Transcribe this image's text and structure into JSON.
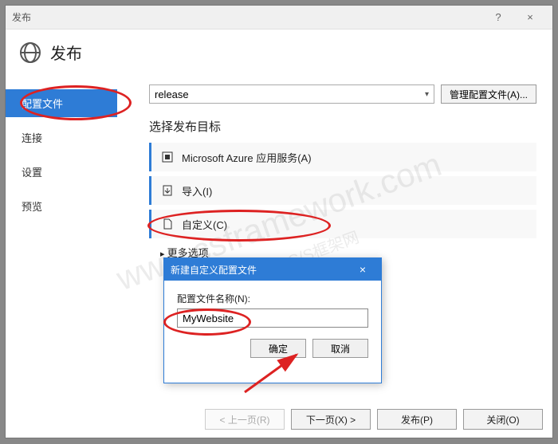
{
  "titlebar": {
    "title": "发布",
    "help": "?",
    "close": "×"
  },
  "header": {
    "title": "发布"
  },
  "sidebar": {
    "items": [
      {
        "label": "配置文件",
        "active": true
      },
      {
        "label": "连接"
      },
      {
        "label": "设置"
      },
      {
        "label": "预览"
      }
    ]
  },
  "config": {
    "selected": "release",
    "manage_label": "管理配置文件(A)..."
  },
  "targets": {
    "heading": "选择发布目标",
    "items": [
      {
        "icon": "azure",
        "label": "Microsoft Azure 应用服务(A)"
      },
      {
        "icon": "import",
        "label": "导入(I)"
      },
      {
        "icon": "doc",
        "label": "自定义(C)"
      }
    ],
    "more": "更多选项"
  },
  "modal": {
    "title": "新建自定义配置文件",
    "label": "配置文件名称(N):",
    "value": "MyWebsite",
    "ok": "确定",
    "cancel": "取消"
  },
  "footer": {
    "prev": "< 上一页(R)",
    "next": "下一页(X) >",
    "publish": "发布(P)",
    "close": "关闭(O)"
  },
  "watermark": {
    "url": "www.csframework.com",
    "cn": "C/S框架网"
  }
}
